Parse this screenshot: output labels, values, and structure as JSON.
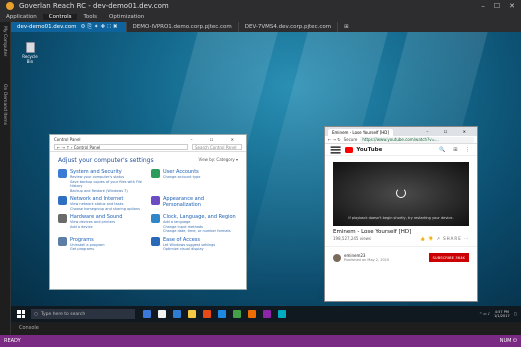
{
  "window": {
    "title": "Goverlan Reach RC - dev-demo01.dev.com",
    "controls": [
      "–",
      "☐",
      "✕"
    ]
  },
  "menu": [
    "Application",
    "Controls",
    "Tools",
    "Optimization"
  ],
  "sidebar": {
    "label_top": "My Computer",
    "label_bottom": "On Demand Items"
  },
  "session_tabs": [
    {
      "label": "dev-demo01.dev.com",
      "icons": "⚙⎘✦✚⛶✖"
    },
    {
      "label": "DEMO-IVPRO1.demo.corp.pjtec.com"
    },
    {
      "label": "DEV-7VMS4.dev.corp.pjtec.com"
    }
  ],
  "session_add": "⊞",
  "desktop": {
    "recycle_bin": "Recycle Bin"
  },
  "control_panel": {
    "title": "Control Panel",
    "breadcrumb": "← → ↑ › Control Panel",
    "search_placeholder": "Search Control Panel",
    "heading": "Adjust your computer's settings",
    "view_by": "View by: Category ▾",
    "items": [
      {
        "title": "System and Security",
        "sub": "Review your computer's status\nSave backup copies of your files with File History\nBackup and Restore (Windows 7)",
        "color": "#3b7bd6"
      },
      {
        "title": "User Accounts",
        "sub": "Change account type",
        "color": "#2e9c5b"
      },
      {
        "title": "Network and Internet",
        "sub": "View network status and tasks\nChoose homegroup and sharing options",
        "color": "#2f6fc2"
      },
      {
        "title": "Appearance and Personalization",
        "sub": "",
        "color": "#6b4cc2"
      },
      {
        "title": "Hardware and Sound",
        "sub": "View devices and printers\nAdd a device",
        "color": "#6a6a6a"
      },
      {
        "title": "Clock, Language, and Region",
        "sub": "Add a language\nChange input methods\nChange date, time, or number formats",
        "color": "#2f86c9"
      },
      {
        "title": "Programs",
        "sub": "Uninstall a program\nGet programs",
        "color": "#5c7da6"
      },
      {
        "title": "Ease of Access",
        "sub": "Let Windows suggest settings\nOptimize visual display",
        "color": "#2a68b8"
      }
    ]
  },
  "browser": {
    "tab_title": "Eminem - Lose Yourself [HD]",
    "controls": "– ☐ ✕",
    "secure_label": "Secure",
    "url": "https://www.youtube.com/watch?v=...",
    "site_name": "YouTube",
    "header_icons": "🔍 ⊞ ⋮",
    "video_caption": "If playback doesn't begin shortly, try restarting your device.",
    "video_title": "Eminem - Lose Yourself [HD]",
    "views": "198,527,245 views",
    "actions": "👍 👎 ↗ SHARE ⋯",
    "channel_name": "eminem23",
    "channel_date": "Published on May 2, 2015",
    "subscribe": "SUBSCRIBE 364K"
  },
  "taskbar": {
    "search_placeholder": "Type here to search",
    "apps": [
      "#3b78d8",
      "#f2f2f2",
      "#2d7dd2",
      "#f6c945",
      "#e64a19",
      "#1e88e5",
      "#43a047",
      "#ef6c00",
      "#8e24aa",
      "#00acc1"
    ],
    "time": "4:57 PM",
    "date": "1/1/2017"
  },
  "console": {
    "label": "Console"
  },
  "statusbar": {
    "left": "READY",
    "right": "NUM ⏻"
  }
}
